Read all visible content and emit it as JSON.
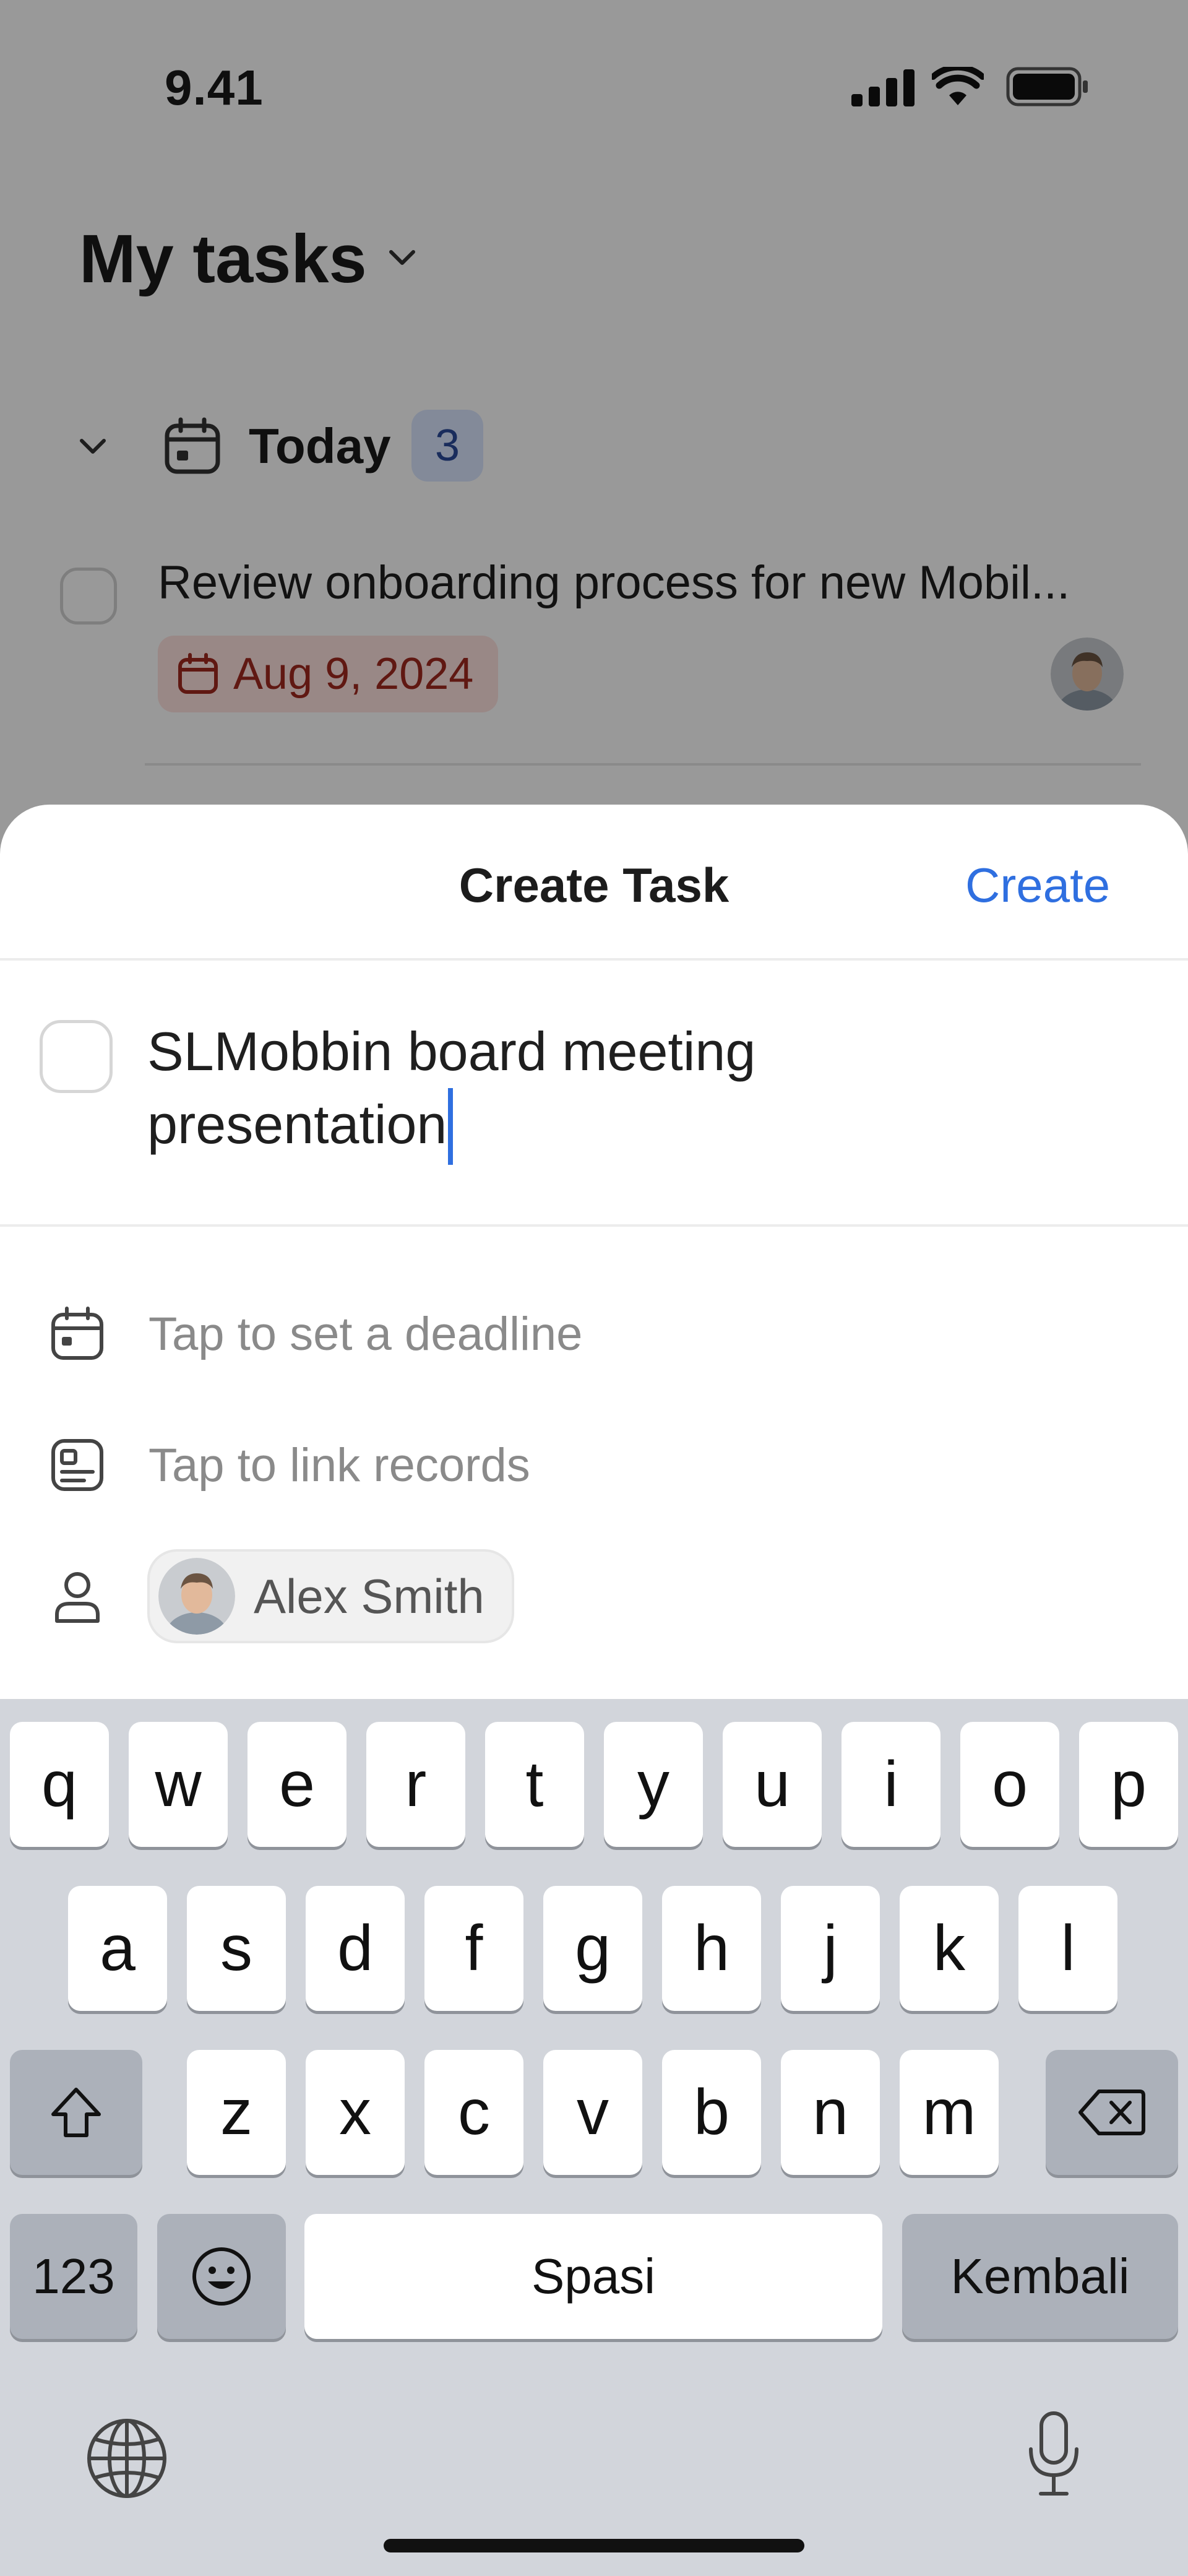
{
  "status_bar": {
    "time": "9.41"
  },
  "background": {
    "title": "My tasks",
    "section": {
      "label": "Today",
      "count": "3"
    },
    "task": {
      "title": "Review onboarding process for new Mobil...",
      "due_date": "Aug 9, 2024"
    }
  },
  "sheet": {
    "title": "Create Task",
    "create_label": "Create",
    "task_title_line1": "SLMobbin board meeting",
    "task_title_line2": "presentation",
    "deadline_placeholder": "Tap to set a deadline",
    "records_placeholder": "Tap to link records",
    "assignee": "Alex Smith"
  },
  "keyboard": {
    "row1": [
      "q",
      "w",
      "e",
      "r",
      "t",
      "y",
      "u",
      "i",
      "o",
      "p"
    ],
    "row2": [
      "a",
      "s",
      "d",
      "f",
      "g",
      "h",
      "j",
      "k",
      "l"
    ],
    "row3": [
      "z",
      "x",
      "c",
      "v",
      "b",
      "n",
      "m"
    ],
    "numbers_label": "123",
    "space_label": "Spasi",
    "return_label": "Kembali"
  },
  "colors": {
    "accent": "#2f6fe0",
    "date_chip_bg": "#ffe3e0",
    "date_chip_text": "#a0281f",
    "badge_bg": "#dbe6ff"
  }
}
